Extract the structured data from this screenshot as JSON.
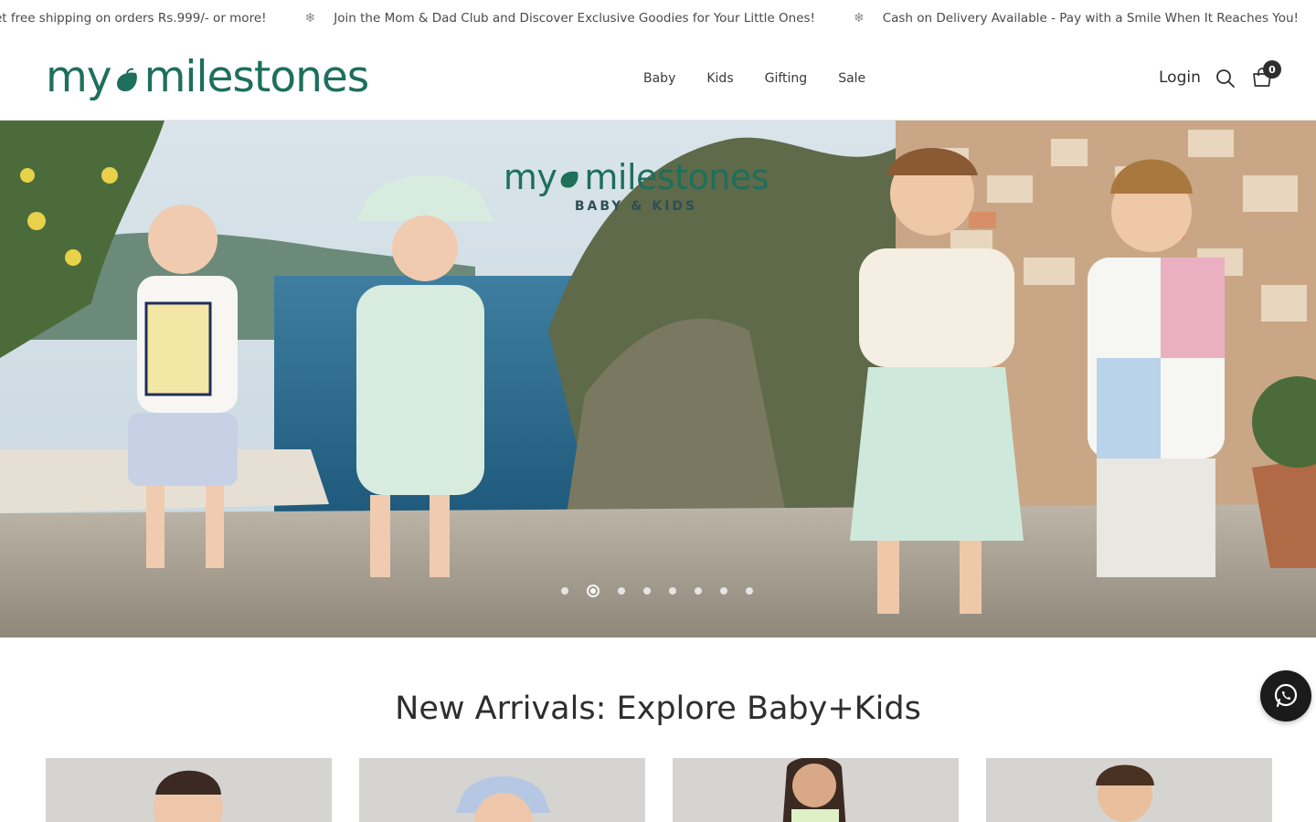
{
  "announcement": {
    "items": [
      "et free shipping on orders Rs.999/- or more!",
      "Join the Mom & Dad Club and Discover Exclusive Goodies for Your Little Ones!",
      "Cash on Delivery Available - Pay with a Smile When It Reaches You!"
    ],
    "separator_icon": "snowflake-icon"
  },
  "header": {
    "logo_text_left": "my",
    "logo_text_right": "milestones",
    "nav": [
      "Baby",
      "Kids",
      "Gifting",
      "Sale"
    ],
    "login_label": "Login",
    "cart_count": "0"
  },
  "hero": {
    "logo_left": "my",
    "logo_right": "milestones",
    "logo_sub": "BABY & KIDS",
    "slide_count": 8,
    "active_slide": 2
  },
  "section": {
    "title": "New Arrivals: Explore Baby+Kids"
  },
  "colors": {
    "brand": "#1e6f5c",
    "text": "#2e2e2e",
    "sea": "#2e6a8e"
  }
}
